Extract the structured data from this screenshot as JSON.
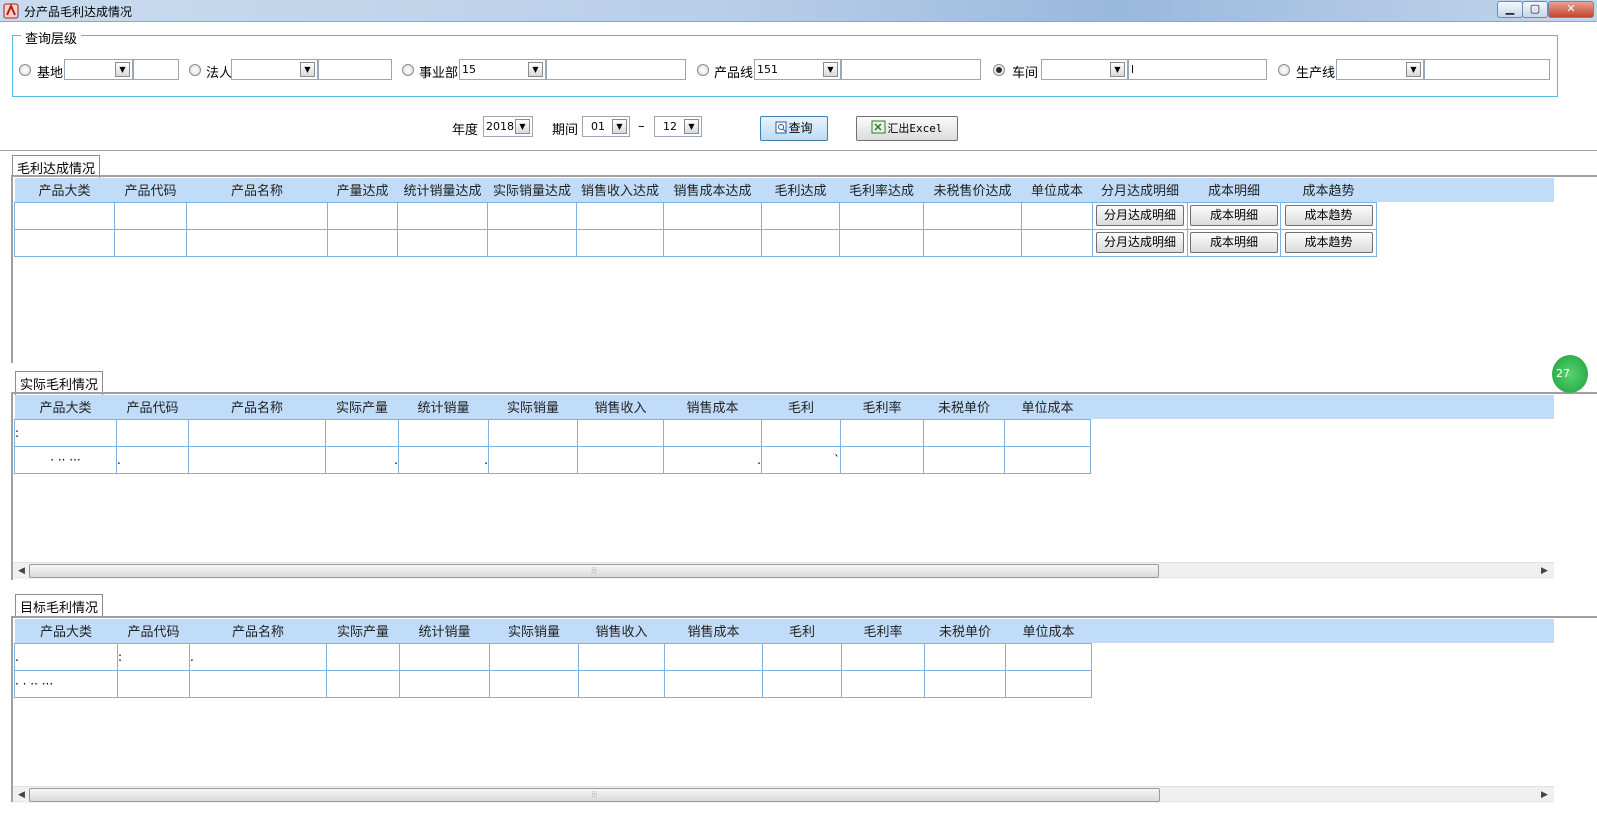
{
  "window": {
    "title": "分产品毛利达成情况",
    "min": "▁",
    "max": "▢",
    "close": "✕"
  },
  "query_group": {
    "label": "查询层级",
    "levels": [
      {
        "label": "基地",
        "value": "",
        "text": "",
        "checked": false
      },
      {
        "label": "法人",
        "value": "",
        "text": "",
        "checked": false
      },
      {
        "label": "事业部",
        "value": "15",
        "text": "",
        "checked": false
      },
      {
        "label": "产品线",
        "value": "151",
        "text": "",
        "checked": false
      },
      {
        "label": "车间",
        "value": "",
        "text": "l",
        "checked": true
      },
      {
        "label": "生产线",
        "value": "",
        "text": "",
        "checked": false
      }
    ]
  },
  "filters": {
    "year_label": "年度",
    "year": "2018",
    "period_label": "期间",
    "period_from": "01",
    "period_sep": "–",
    "period_to": "12",
    "query_btn": "查询",
    "export_btn": "汇出Excel"
  },
  "sections": {
    "achievement": {
      "title": "毛利达成情况",
      "columns": [
        "产品大类",
        "产品代码",
        "产品名称",
        "产量达成",
        "统计销量达成",
        "实际销量达成",
        "销售收入达成",
        "销售成本达成",
        "毛利达成",
        "毛利率达成",
        "未税售价达成",
        "单位成本",
        "分月达成明细",
        "成本明细",
        "成本趋势"
      ],
      "row_buttons": {
        "monthly": "分月达成明细",
        "cost_detail": "成本明细",
        "cost_trend": "成本趋势"
      },
      "rows": [
        [
          "",
          "",
          "",
          "",
          "",
          "",
          "",
          "",
          "",
          "",
          "",
          ""
        ],
        [
          "",
          "",
          "",
          "",
          "",
          "",
          "",
          "",
          "",
          "",
          "",
          ""
        ]
      ]
    },
    "actual": {
      "title": "实际毛利情况",
      "columns": [
        "产品大类",
        "产品代码",
        "产品名称",
        "实际产量",
        "统计销量",
        "实际销量",
        "销售收入",
        "销售成本",
        "毛利",
        "毛利率",
        "未税单价",
        "单位成本"
      ],
      "rows": [
        [
          ":",
          "",
          "",
          "",
          "",
          "",
          "",
          "",
          "",
          "",
          "",
          ""
        ],
        [
          "·  ··  ···",
          ".",
          "",
          ".",
          ".",
          "",
          "",
          ".",
          "`",
          "",
          "",
          ""
        ]
      ]
    },
    "target": {
      "title": "目标毛利情况",
      "columns": [
        "产品大类",
        "产品代码",
        "产品名称",
        "实际产量",
        "统计销量",
        "实际销量",
        "销售收入",
        "销售成本",
        "毛利",
        "毛利率",
        "未税单价",
        "单位成本"
      ],
      "rows": [
        [
          ".",
          ":",
          ".",
          "",
          "",
          "",
          "",
          "",
          "",
          "",
          "",
          ""
        ],
        [
          "·  ·  ··  ···",
          "",
          "",
          "",
          "",
          "",
          "",
          "",
          "",
          "",
          "",
          ""
        ]
      ]
    }
  },
  "badge": "27"
}
